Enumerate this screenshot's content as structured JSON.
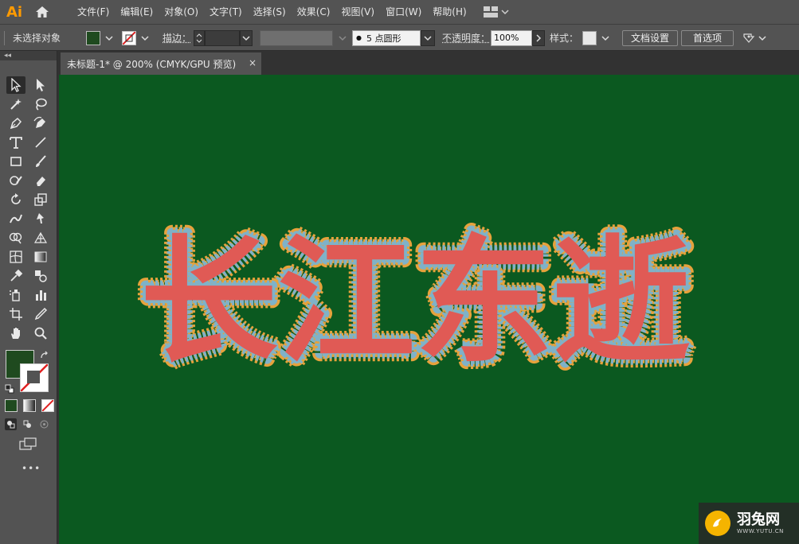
{
  "app": {
    "logo": "Ai"
  },
  "menu": [
    "文件(F)",
    "编辑(E)",
    "对象(O)",
    "文字(T)",
    "选择(S)",
    "效果(C)",
    "视图(V)",
    "窗口(W)",
    "帮助(H)"
  ],
  "control": {
    "selection_label": "未选择对象",
    "fill_color": "#1f4a1f",
    "stroke_label": "描边：",
    "brush_dot": "●",
    "brush_value": "5 点圆形",
    "opacity_label": "不透明度：",
    "opacity_value": "100%",
    "style_label": "样式：",
    "doc_settings": "文档设置",
    "preferences": "首选项"
  },
  "toolbar": {
    "collapse": "◂◂",
    "more": "•••"
  },
  "document": {
    "tab_title": "未标题-1* @ 200% (CMYK/GPU 预览)",
    "close": "×"
  },
  "artwork": {
    "text": "长江东逝",
    "fill": "#e05a55",
    "stroke_outer": "#e6a23c",
    "stroke_inner": "#7fb2c8",
    "canvas_color": "#0b5920"
  },
  "watermark": {
    "title": "羽兔网",
    "url": "WWW.YUTU.CN"
  }
}
